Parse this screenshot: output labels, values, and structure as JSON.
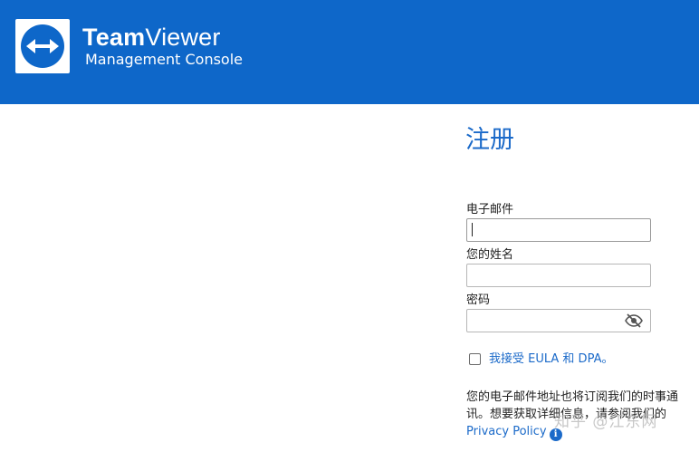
{
  "header": {
    "brand_bold": "Team",
    "brand_regular": "Viewer",
    "subtitle": "Management Console",
    "background": "#0e67c9"
  },
  "form": {
    "title": "注册",
    "email_label": "电子邮件",
    "email_value": "",
    "name_label": "您的姓名",
    "name_value": "",
    "password_label": "密码",
    "password_value": "",
    "show_password_icon": "eye-slash-icon",
    "agree_text": "我接受 EULA 和 DPA。",
    "agree_checked": false,
    "note_text": "您的电子邮件地址也将订阅我们的时事通讯。想要获取详细信息，请参阅我们的 ",
    "privacy_link": "Privacy Policy",
    "info_icon_glyph": "i",
    "accent": "#1b6ac9"
  },
  "watermark": "知乎 @江东网"
}
